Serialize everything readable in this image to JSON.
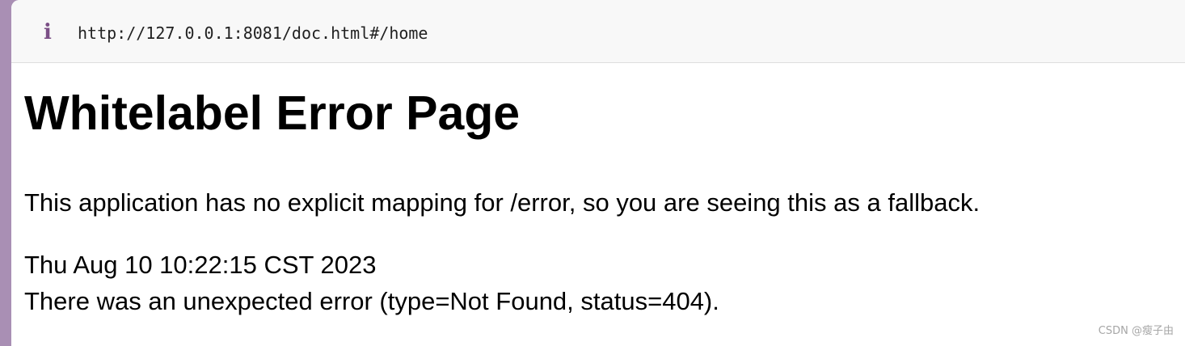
{
  "address_bar": {
    "icon": "info-icon",
    "icon_glyph": "i",
    "url": "http://127.0.0.1:8081/doc.html#/home"
  },
  "page": {
    "title": "Whitelabel Error Page",
    "message": "This application has no explicit mapping for /error, so you are seeing this as a fallback.",
    "timestamp": "Thu Aug 10 10:22:15 CST 2023",
    "error_detail": "There was an unexpected error (type=Not Found, status=404)."
  },
  "watermark": "CSDN @瘦子由",
  "colors": {
    "icon": "#7b4f86",
    "address_bar_bg": "#f8f8f8",
    "desktop_bg": "#a98fb4"
  }
}
